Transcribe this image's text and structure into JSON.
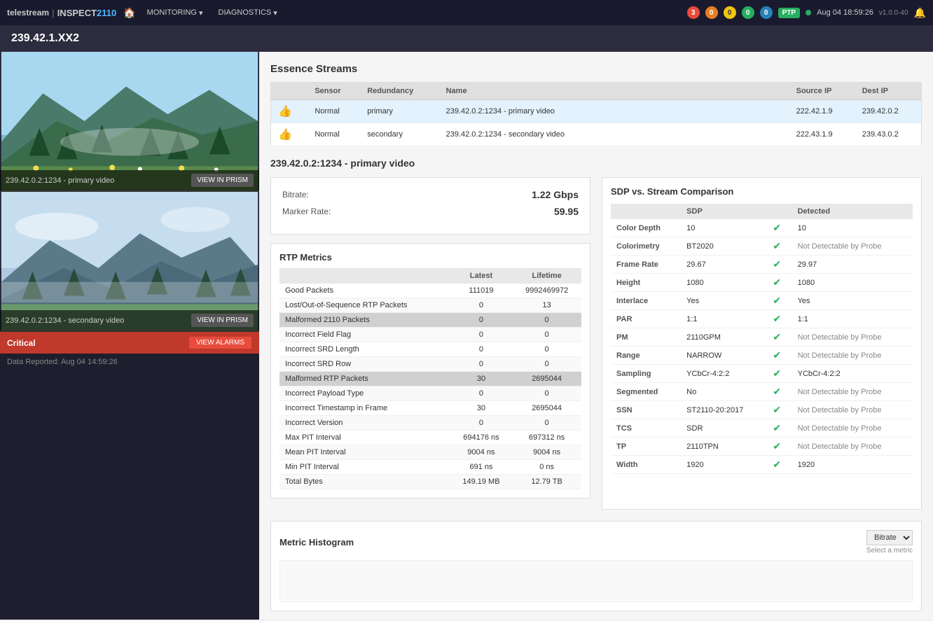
{
  "nav": {
    "logo_text": "telestream",
    "logo_divider": "|",
    "app_name_prefix": "INSPECT",
    "app_name_suffix": "2110",
    "home_icon": "🏠",
    "monitoring_label": "MONITORING",
    "diagnostics_label": "DIAGNOSTICS",
    "badges": [
      {
        "count": "3",
        "type": "red"
      },
      {
        "count": "0",
        "type": "orange"
      },
      {
        "count": "0",
        "type": "yellow"
      },
      {
        "count": "0",
        "type": "green"
      },
      {
        "count": "0",
        "type": "blue"
      }
    ],
    "ptp_label": "PTP",
    "timestamp": "Aug 04 18:59:26",
    "version": "v1.0.0-40",
    "bell_icon": "🔔"
  },
  "page": {
    "title": "239.42.1.XX2"
  },
  "essence_streams": {
    "section_title": "Essence Streams",
    "columns": [
      "Sensor",
      "Redundancy",
      "Name",
      "Source IP",
      "Dest IP"
    ],
    "rows": [
      {
        "icon": "👍",
        "sensor_type": "Normal",
        "redundancy": "primary",
        "name": "239.42.0.2:1234 - primary video",
        "source_ip": "222.42.1.9",
        "dest_ip": "239.42.0.2",
        "selected": true
      },
      {
        "icon": "👍",
        "sensor_type": "Normal",
        "redundancy": "secondary",
        "name": "239.42.0.2:1234 - secondary video",
        "source_ip": "222.43.1.9",
        "dest_ip": "239.43.0.2",
        "selected": false
      }
    ]
  },
  "stream_detail": {
    "title": "239.42.0.2:1234 - primary video",
    "bitrate_label": "Bitrate:",
    "bitrate_value": "1.22 Gbps",
    "marker_rate_label": "Marker Rate:",
    "marker_rate_value": "59.95"
  },
  "rtp_metrics": {
    "title": "RTP Metrics",
    "col_latest": "Latest",
    "col_lifetime": "Lifetime",
    "rows": [
      {
        "label": "Good Packets",
        "latest": "111019",
        "lifetime": "9992469972",
        "highlight": false
      },
      {
        "label": "Lost/Out-of-Sequence RTP Packets",
        "latest": "0",
        "lifetime": "13",
        "highlight": false
      },
      {
        "label": "Malformed 2110 Packets",
        "latest": "0",
        "lifetime": "0",
        "highlight": true
      },
      {
        "label": "Incorrect Field Flag",
        "latest": "0",
        "lifetime": "0",
        "highlight": false
      },
      {
        "label": "Incorrect SRD Length",
        "latest": "0",
        "lifetime": "0",
        "highlight": false
      },
      {
        "label": "Incorrect SRD Row",
        "latest": "0",
        "lifetime": "0",
        "highlight": false
      },
      {
        "label": "Malformed RTP Packets",
        "latest": "30",
        "lifetime": "2695044",
        "highlight": true
      },
      {
        "label": "Incorrect Payload Type",
        "latest": "0",
        "lifetime": "0",
        "highlight": false
      },
      {
        "label": "Incorrect Timestamp in Frame",
        "latest": "30",
        "lifetime": "2695044",
        "highlight": false
      },
      {
        "label": "Incorrect Version",
        "latest": "0",
        "lifetime": "0",
        "highlight": false
      },
      {
        "label": "Max PIT Interval",
        "latest": "694176 ns",
        "lifetime": "697312 ns",
        "highlight": false
      },
      {
        "label": "Mean PIT Interval",
        "latest": "9004 ns",
        "lifetime": "9004 ns",
        "highlight": false
      },
      {
        "label": "Min PIT Interval",
        "latest": "691 ns",
        "lifetime": "0 ns",
        "highlight": false
      },
      {
        "label": "Total Bytes",
        "latest": "149.19 MB",
        "lifetime": "12.79 TB",
        "highlight": false
      }
    ]
  },
  "sdp_comparison": {
    "title": "SDP vs. Stream Comparison",
    "col_sdp": "SDP",
    "col_detected": "Detected",
    "rows": [
      {
        "field": "Color Depth",
        "sdp": "10",
        "match": true,
        "detected": "10"
      },
      {
        "field": "Colorimetry",
        "sdp": "BT2020",
        "match": true,
        "detected": "Not Detectable by Probe"
      },
      {
        "field": "Frame Rate",
        "sdp": "29.67",
        "match": true,
        "detected": "29.97"
      },
      {
        "field": "Height",
        "sdp": "1080",
        "match": true,
        "detected": "1080"
      },
      {
        "field": "Interlace",
        "sdp": "Yes",
        "match": true,
        "detected": "Yes"
      },
      {
        "field": "PAR",
        "sdp": "1:1",
        "match": true,
        "detected": "1:1"
      },
      {
        "field": "PM",
        "sdp": "2110GPM",
        "match": true,
        "detected": "Not Detectable by Probe"
      },
      {
        "field": "Range",
        "sdp": "NARROW",
        "match": true,
        "detected": "Not Detectable by Probe"
      },
      {
        "field": "Sampling",
        "sdp": "YCbCr-4:2:2",
        "match": true,
        "detected": "YCbCr-4:2:2"
      },
      {
        "field": "Segmented",
        "sdp": "No",
        "match": true,
        "detected": "Not Detectable by Probe"
      },
      {
        "field": "SSN",
        "sdp": "ST2110-20:2017",
        "match": true,
        "detected": "Not Detectable by Probe"
      },
      {
        "field": "TCS",
        "sdp": "SDR",
        "match": true,
        "detected": "Not Detectable by Probe"
      },
      {
        "field": "TP",
        "sdp": "2110TPN",
        "match": true,
        "detected": "Not Detectable by Probe"
      },
      {
        "field": "Width",
        "sdp": "1920",
        "match": true,
        "detected": "1920"
      }
    ]
  },
  "metric_histogram": {
    "title": "Metric Histogram",
    "select_label": "Bitrate",
    "select_sub": "Select a metric"
  },
  "left_panel": {
    "video1_label": "239.42.0.2:1234 - primary video",
    "video2_label": "239.42.0.2:1234 - secondary video",
    "view_prism_label": "VIEW IN PRISM",
    "critical_label": "Critical",
    "view_alarms_label": "VIEW ALARMS",
    "data_reported": "Data Reported: Aug 04 14:59:26"
  }
}
